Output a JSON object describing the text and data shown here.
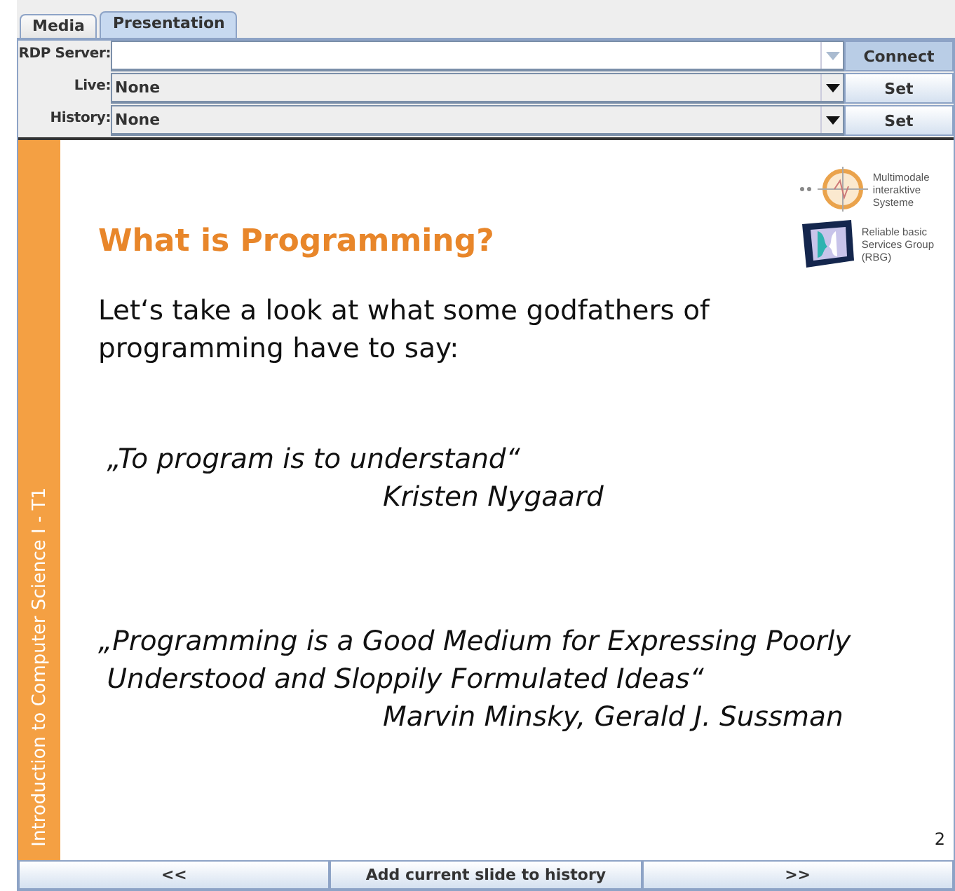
{
  "tabs": [
    {
      "label": "Media",
      "selected": false
    },
    {
      "label": "Presentation",
      "selected": true
    }
  ],
  "controls": [
    {
      "label": "RDP Server:",
      "editable": true,
      "button": "Connect",
      "button_focused": true
    },
    {
      "label": "Live:",
      "value": "None",
      "editable": false,
      "button": "Set",
      "button_focused": false
    },
    {
      "label": "History:",
      "value": "None",
      "editable": false,
      "button": "Set",
      "button_focused": false
    }
  ],
  "slide": {
    "sidebar_text": "Introduction to Computer Science I - T1",
    "logos": [
      {
        "lines": [
          "Multimodale",
          "interaktive",
          "Systeme"
        ]
      },
      {
        "lines": [
          "Reliable basic",
          "Services Group",
          "(RBG)"
        ]
      }
    ],
    "title": "What is Programming?",
    "intro": [
      "Let‘s take a look at what some godfathers of",
      "programming have to say:"
    ],
    "quotes": [
      {
        "lines": [
          " „To program is to understand“"
        ],
        "author": "Kristen Nygaard"
      },
      {
        "lines": [
          "„Programming is a Good Medium for Expressing Poorly",
          " Understood and Sloppily Formulated Ideas“"
        ],
        "author": "Marvin Minsky, Gerald J. Sussman"
      }
    ],
    "page_number": "2"
  },
  "nav_buttons": [
    "<<",
    "Add current slide to history",
    ">>"
  ]
}
